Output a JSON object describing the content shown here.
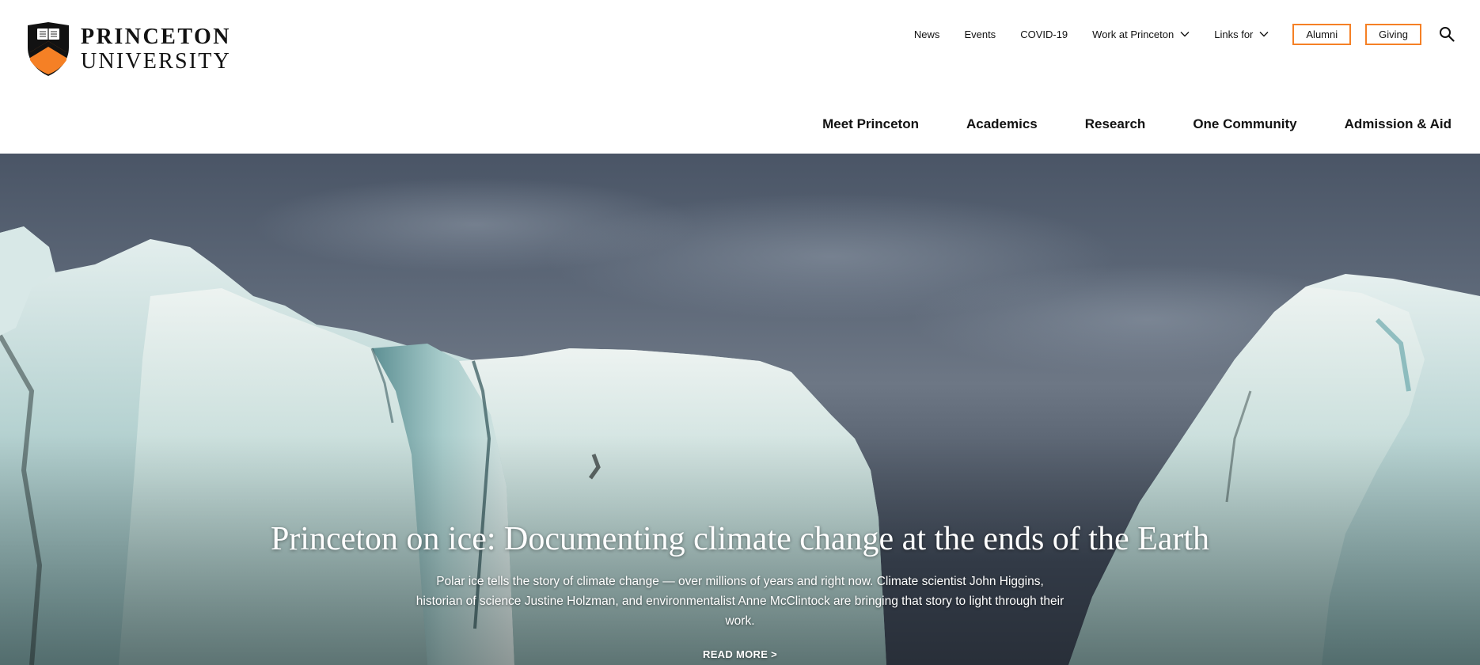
{
  "logo": {
    "line1": "PRINCETON",
    "line2": "UNIVERSITY",
    "icon": "shield-icon"
  },
  "utility_nav": {
    "links": [
      {
        "label": "News",
        "has_dropdown": false
      },
      {
        "label": "Events",
        "has_dropdown": false
      },
      {
        "label": "COVID-19",
        "has_dropdown": false
      },
      {
        "label": "Work at Princeton",
        "has_dropdown": true
      },
      {
        "label": "Links for",
        "has_dropdown": true
      }
    ],
    "buttons": [
      {
        "label": "Alumni"
      },
      {
        "label": "Giving"
      }
    ],
    "search_icon": "search-icon"
  },
  "main_nav": {
    "items": [
      {
        "label": "Meet Princeton"
      },
      {
        "label": "Academics"
      },
      {
        "label": "Research"
      },
      {
        "label": "One Community"
      },
      {
        "label": "Admission & Aid"
      }
    ]
  },
  "hero": {
    "headline": "Princeton on ice: Documenting climate change at the ends of the Earth",
    "dek": "Polar ice tells the story of climate change — over millions of years and right now. Climate scientist John Higgins, historian of science Justine Holzman, and environmentalist Anne McClintock are bringing that story to light through their work.",
    "read_more": "READ MORE >"
  },
  "colors": {
    "accent_orange": "#f58025",
    "text_dark": "#121212",
    "white": "#ffffff"
  }
}
